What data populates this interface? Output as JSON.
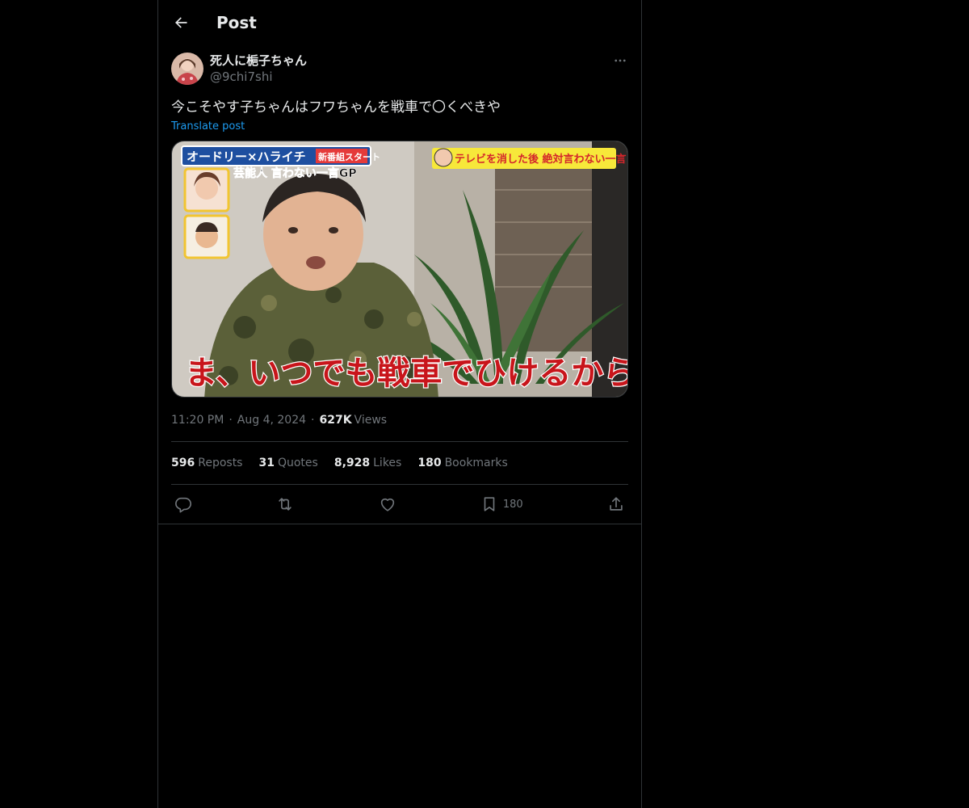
{
  "header": {
    "title": "Post"
  },
  "author": {
    "display_name": "死人に梔子ちゃん",
    "handle": "@9chi7shi"
  },
  "post": {
    "text": "今こそやす子ちゃんはフワちゃんを戦車で〇くべきや",
    "translate_label": "Translate post",
    "media": {
      "banner_left": "オードリー×ハライチ",
      "banner_new": "新番組スタート",
      "subtitle": "芸能人 言わない一言GP",
      "banner_right": "テレビを消した後 絶対言わない一言",
      "caption": "ま、いつでも戦車でひけるからな〜"
    },
    "time": "11:20 PM",
    "date": "Aug 4, 2024",
    "views_count": "627K",
    "views_label": "Views"
  },
  "stats": [
    {
      "count": "596",
      "label": "Reposts"
    },
    {
      "count": "31",
      "label": "Quotes"
    },
    {
      "count": "8,928",
      "label": "Likes"
    },
    {
      "count": "180",
      "label": "Bookmarks"
    }
  ],
  "actions": {
    "bookmark_count": "180"
  },
  "icons": [
    "back-arrow-icon",
    "more-icon",
    "reply-icon",
    "repost-icon",
    "like-icon",
    "bookmark-icon",
    "share-icon"
  ],
  "colors": {
    "accent": "#1d9bf0",
    "background": "#000000",
    "border": "#2f3336",
    "muted": "#71767b"
  }
}
